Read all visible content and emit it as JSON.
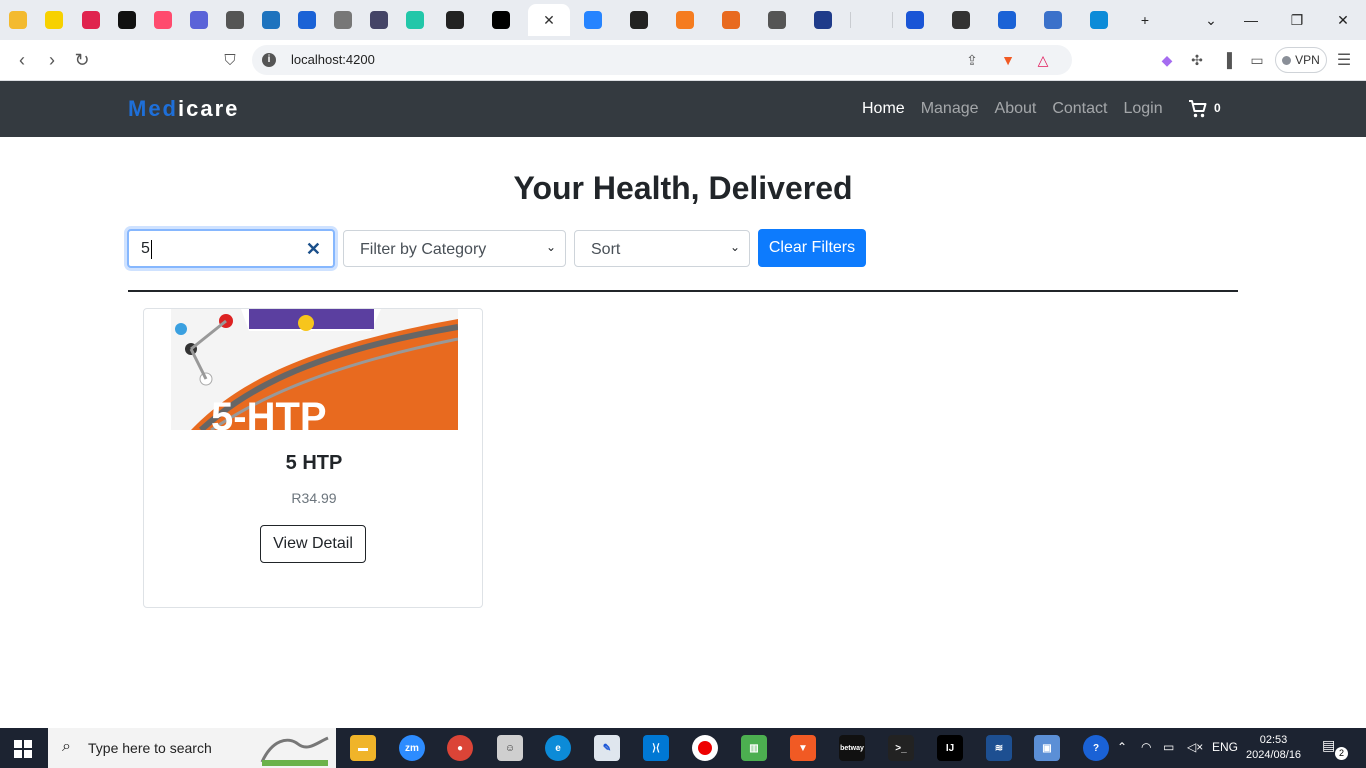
{
  "browser": {
    "url": "localhost:4200",
    "vpn_label": "VPN",
    "tabs": [
      {
        "icon": "binance-icon",
        "color": "#f3ba2f"
      },
      {
        "icon": "pen-icon",
        "color": "#f7d100"
      },
      {
        "icon": "nestjs-icon",
        "color": "#e0234e"
      },
      {
        "icon": "crown-icon",
        "color": "#111111"
      },
      {
        "icon": "p-icon",
        "color": "#ff4b6e"
      },
      {
        "icon": "75-icon",
        "color": "#5a63d8"
      },
      {
        "icon": "globe-icon",
        "color": "#555555"
      },
      {
        "icon": "js-icon",
        "color": "#1e73be"
      },
      {
        "icon": "terminal-arrow-icon",
        "color": "#1a62d6"
      },
      {
        "icon": "globe-icon",
        "color": "#777777"
      },
      {
        "icon": "chat-icon",
        "color": "#444466"
      },
      {
        "icon": "ai-icon",
        "color": "#22c7a9"
      },
      {
        "icon": "github-icon",
        "color": "#222222"
      },
      {
        "icon": "medium-icon",
        "color": "#000000"
      },
      {
        "icon": "close-icon",
        "color": "#ffffff"
      },
      {
        "icon": "bitbucket-icon",
        "color": "#2684ff"
      },
      {
        "icon": "github-icon",
        "color": "#222222"
      },
      {
        "icon": "cube-icon",
        "color": "#f57c20"
      },
      {
        "icon": "copy-icon",
        "color": "#e86a1f"
      },
      {
        "icon": "globe-icon",
        "color": "#555555"
      },
      {
        "icon": "powershell-icon",
        "color": "#1f3b8a"
      },
      {
        "icon": "blank-icon",
        "color": "#e9ecf1"
      },
      {
        "icon": "forms-icon",
        "color": "#1a55d6"
      },
      {
        "icon": "openai-icon",
        "color": "#333333"
      },
      {
        "icon": "play-icon",
        "color": "#1a62d6"
      },
      {
        "icon": "mdb-icon",
        "color": "#3b71ca"
      },
      {
        "icon": "edge-icon",
        "color": "#0c8bd8"
      }
    ]
  },
  "site": {
    "brand_part1": "Med",
    "brand_part2": "icare",
    "nav": [
      "Home",
      "Manage",
      "About",
      "Contact",
      "Login"
    ],
    "cart_count": "0",
    "headline": "Your Health, Delivered",
    "search_value": "5",
    "category_placeholder": "Filter by Category",
    "sort_placeholder": "Sort",
    "clear_filters": "Clear Filters",
    "products": [
      {
        "name": "5 HTP",
        "price": "R34.99",
        "button": "View Detail"
      }
    ]
  },
  "taskbar": {
    "search_placeholder": "Type here to search",
    "language": "ENG",
    "time": "02:53",
    "date": "2024/08/16",
    "notifications": "2"
  }
}
